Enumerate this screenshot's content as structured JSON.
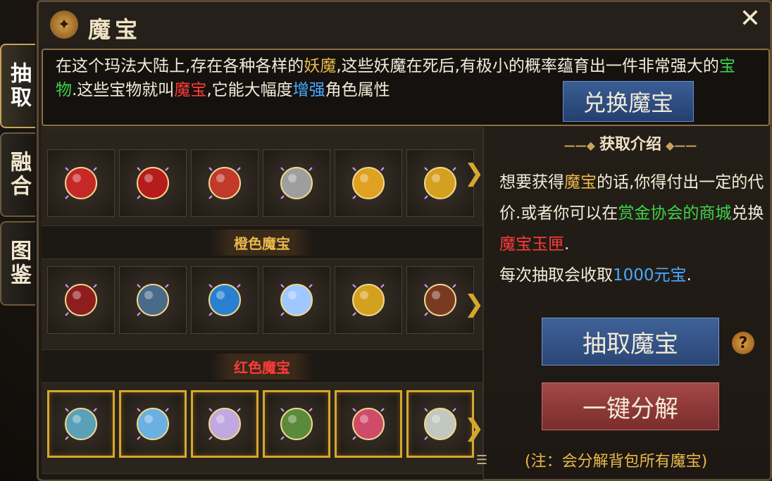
{
  "side_tabs": [
    {
      "label": "抽取",
      "active": true
    },
    {
      "label": "融合",
      "active": false
    },
    {
      "label": "图鉴",
      "active": false
    }
  ],
  "window": {
    "title": "魔宝",
    "close_icon": "close-icon"
  },
  "description": {
    "segments": [
      {
        "text": "在这个玛法大陆上,存在各种各样的",
        "color": "#f4ecd8"
      },
      {
        "text": "妖魔",
        "color": "#e9b84a"
      },
      {
        "text": ",这些妖魔在死后,有极小的概率蕴育出一件非常强大的",
        "color": "#f4ecd8"
      },
      {
        "text": "宝物",
        "color": "#3ed24a"
      },
      {
        "text": ".这些宝物就叫",
        "color": "#f4ecd8"
      },
      {
        "text": "魔宝",
        "color": "#ff3a3a"
      },
      {
        "text": ",它能大幅度",
        "color": "#f4ecd8"
      },
      {
        "text": "增强",
        "color": "#4aa9ff"
      },
      {
        "text": "角色属性",
        "color": "#f4ecd8"
      }
    ],
    "exchange_button": "兑换魔宝"
  },
  "sections": [
    {
      "header": "",
      "header_color": "#b85ee0",
      "framed": false,
      "items": [
        "firecracker-item",
        "red-trinket-item",
        "red-shield-item",
        "sword-item",
        "golden-hammer-item",
        "gold-pot-item"
      ]
    },
    {
      "header": "橙色魔宝",
      "header_color": "#e9b84a",
      "framed": false,
      "items": [
        "heart-item",
        "chain-item",
        "blue-potion-item",
        "ice-flower-item",
        "horse-coin-item",
        "leather-bag-item"
      ]
    },
    {
      "header": "红色魔宝",
      "header_color": "#ff3a3a",
      "framed": true,
      "items": [
        "eye-item",
        "crystal-item",
        "shell-item",
        "jade-box-item",
        "rose-item",
        "ring-item"
      ]
    }
  ],
  "info": {
    "title": "获取介绍",
    "line1_segments": [
      {
        "text": "想要获得",
        "color": "#f4ecd8"
      },
      {
        "text": "魔宝",
        "color": "#e9b84a"
      },
      {
        "text": "的话,你得付出一定的代价.或者你可以在",
        "color": "#f4ecd8"
      },
      {
        "text": "赏金协会的商城",
        "color": "#3ed24a"
      },
      {
        "text": "兑换",
        "color": "#f4ecd8"
      },
      {
        "text": "魔宝玉匣",
        "color": "#ff3a3a"
      },
      {
        "text": ".",
        "color": "#f4ecd8"
      }
    ],
    "cost_prefix": "每次抽取会收取",
    "cost_value": "1000元宝",
    "cost_suffix": ".",
    "draw_button": "抽取魔宝",
    "help_label": "?",
    "decompose_button": "一键分解",
    "note": "(注：会分解背包所有魔宝)"
  }
}
